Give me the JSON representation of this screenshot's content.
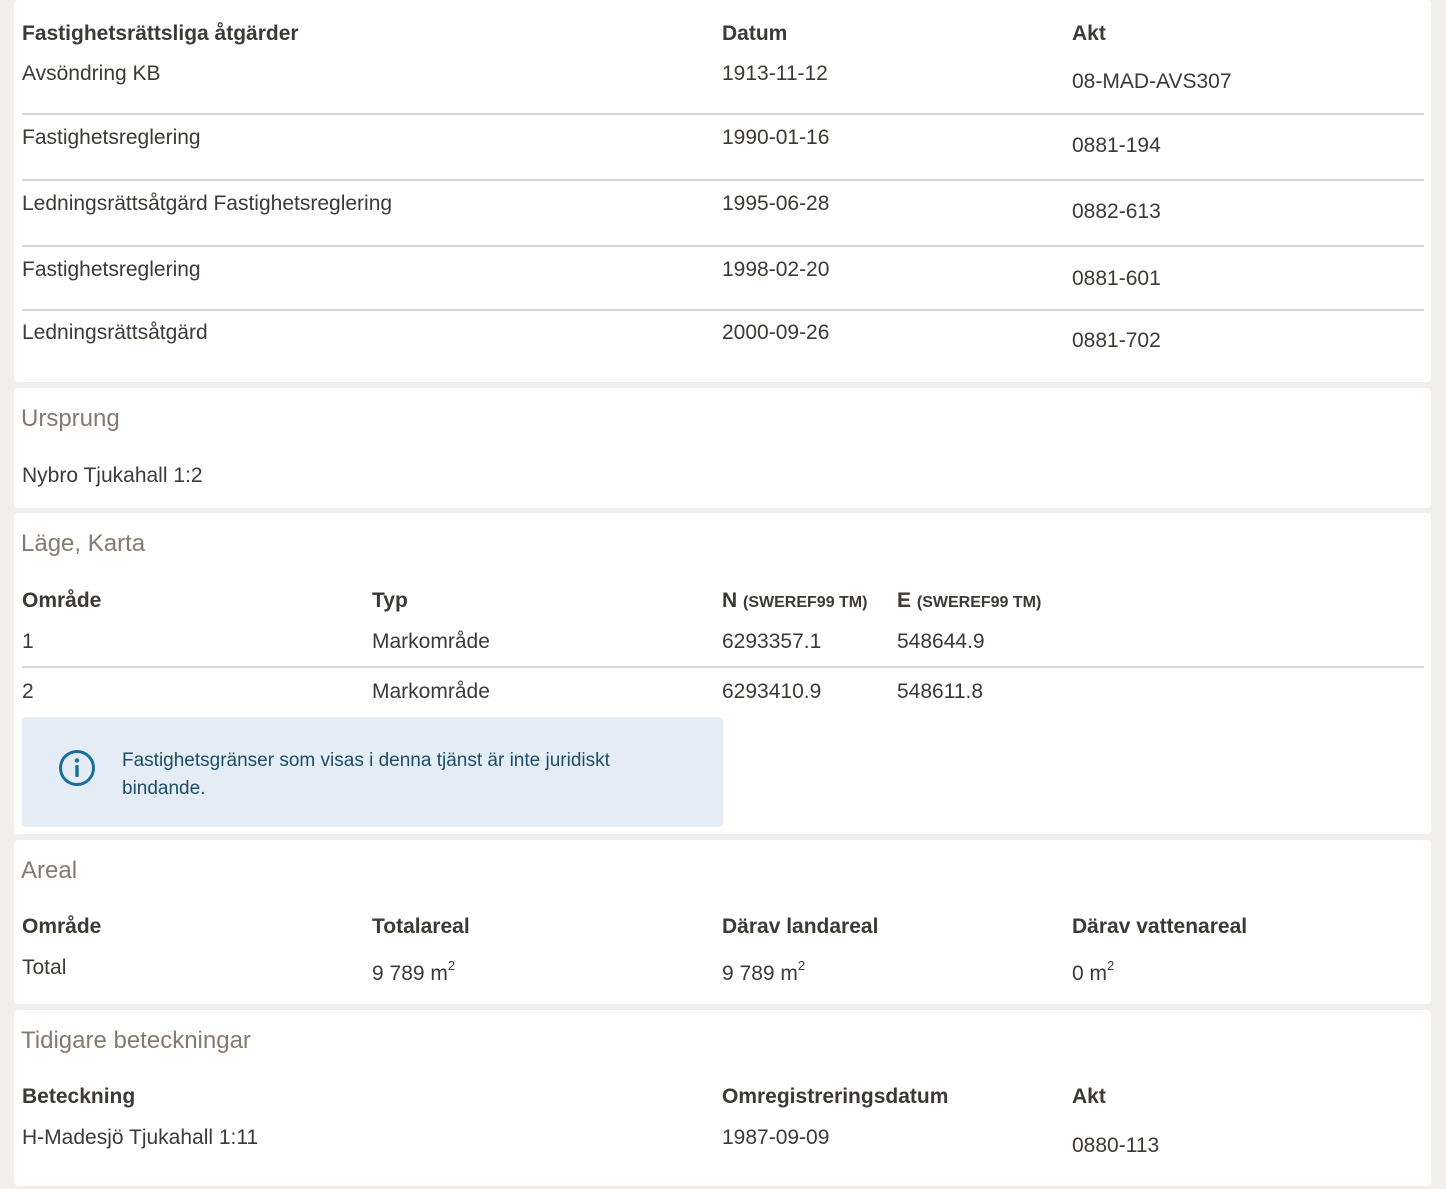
{
  "actions": {
    "headers": [
      "Fastighetsrättsliga åtgärder",
      "Datum",
      "Akt"
    ],
    "rows": [
      {
        "name": "Avsöndring KB",
        "date": "1913-11-12",
        "akt": "08-MAD-AVS307"
      },
      {
        "name": "Fastighetsreglering",
        "date": "1990-01-16",
        "akt": "0881-194"
      },
      {
        "name": "Ledningsrättsåtgärd Fastighetsreglering",
        "date": "1995-06-28",
        "akt": "0882-613"
      },
      {
        "name": "Fastighetsreglering",
        "date": "1998-02-20",
        "akt": "0881-601"
      },
      {
        "name": "Ledningsrättsåtgärd",
        "date": "2000-09-26",
        "akt": "0881-702"
      }
    ]
  },
  "ursprung": {
    "title": "Ursprung",
    "value": "Nybro Tjukahall 1:2"
  },
  "lage": {
    "title": "Läge, Karta",
    "headers": {
      "omrade": "Område",
      "typ": "Typ",
      "n": "N",
      "n_sub": "(SWEREF99 TM)",
      "e": "E",
      "e_sub": "(SWEREF99 TM)"
    },
    "rows": [
      {
        "omrade": "1",
        "typ": "Markområde",
        "n": "6293357.1",
        "e": "548644.9"
      },
      {
        "omrade": "2",
        "typ": "Markområde",
        "n": "6293410.9",
        "e": "548611.8"
      }
    ],
    "info": {
      "icon": "info-icon",
      "text": "Fastighetsgränser som visas i denna tjänst är inte juridiskt bindande."
    }
  },
  "areal": {
    "title": "Areal",
    "headers": [
      "Område",
      "Totalareal",
      "Därav landareal",
      "Därav vattenareal"
    ],
    "row": {
      "omrade": "Total",
      "total": "9 789 m",
      "land": "9 789 m",
      "vatten": "0 m",
      "unit_sup": "2"
    }
  },
  "tidigare": {
    "title": "Tidigare beteckningar",
    "headers": [
      "Beteckning",
      "Omregistreringsdatum",
      "Akt"
    ],
    "row": {
      "beteckning": "H-Madesjö Tjukahall 1:11",
      "date": "1987-09-09",
      "akt": "0880-113"
    }
  },
  "colors": {
    "page_bg": "#f1efed",
    "card_bg": "#ffffff",
    "section_title": "#857a70",
    "text": "#3d3935",
    "info_bg": "#e4ecf5",
    "info_accent": "#1a6e9c"
  }
}
